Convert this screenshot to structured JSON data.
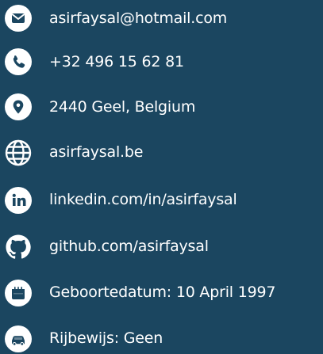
{
  "colors": {
    "background": "#1b4660",
    "text": "#ffffff",
    "icon": "#ffffff",
    "icon_glyph": "#1b4660"
  },
  "contact": {
    "items": [
      {
        "icon": "email-icon",
        "text": "asirfaysal@hotmail.com"
      },
      {
        "icon": "phone-icon",
        "text": "+32 496 15 62 81"
      },
      {
        "icon": "location-icon",
        "text": "2440 Geel, Belgium"
      },
      {
        "icon": "globe-icon",
        "text": "asirfaysal.be"
      },
      {
        "icon": "linkedin-icon",
        "text": "linkedin.com/in/asirfaysal"
      },
      {
        "icon": "github-icon",
        "text": "github.com/asirfaysal"
      },
      {
        "icon": "birthday-icon",
        "text": "Geboortedatum: 10 April 1997"
      },
      {
        "icon": "car-icon",
        "text": "Rijbewijs: Geen"
      }
    ]
  }
}
